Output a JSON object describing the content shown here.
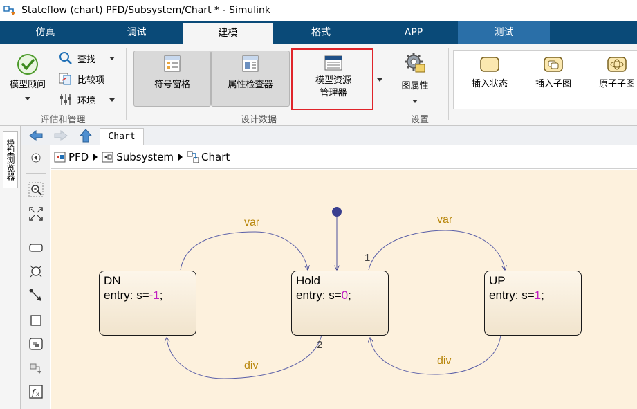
{
  "window": {
    "title": "Stateflow (chart) PFD/Subsystem/Chart * - Simulink"
  },
  "tabs": [
    "仿真",
    "调试",
    "建模",
    "格式",
    "APP",
    "测试"
  ],
  "ribbon": {
    "evaluate": {
      "advisor": "模型顾问",
      "find": "查找",
      "compare": "比较项",
      "environment": "环境",
      "group_label": "评估和管理"
    },
    "design": {
      "symbols": "符号窗格",
      "inspector": "属性检查器",
      "explorer_line1": "模型资源",
      "explorer_line2": "管理器",
      "group_label": "设计数据"
    },
    "setup": {
      "chart_props": "图属性",
      "group_label": "设置"
    },
    "insert": {
      "state": "插入状态",
      "subchart": "插入子图",
      "atomic": "原子子图"
    }
  },
  "left_strip": {
    "model_browser": "模型浏览器"
  },
  "nav": {
    "tab": "Chart"
  },
  "breadcrumb": [
    "PFD",
    "Subsystem",
    "Chart"
  ],
  "chart": {
    "states": [
      {
        "name": "DN",
        "entry_prefix": "entry: s=",
        "entry_value": "-1",
        "entry_suffix": ";"
      },
      {
        "name": "Hold",
        "entry_prefix": "entry: s=",
        "entry_value": "0",
        "entry_suffix": ";"
      },
      {
        "name": "UP",
        "entry_prefix": "entry: s=",
        "entry_value": "1",
        "entry_suffix": ";"
      }
    ],
    "transitions": {
      "dn_to_hold": "var",
      "hold_to_up": "var",
      "hold_to_dn": "div",
      "up_to_hold": "div"
    },
    "orders": {
      "first": "1",
      "second": "2"
    }
  },
  "colors": {
    "tab_bar": "#0a4a78",
    "canvas": "#fdf1dd",
    "label": "#b8860b",
    "highlight": "#e0242a",
    "value": "#c020c0"
  }
}
